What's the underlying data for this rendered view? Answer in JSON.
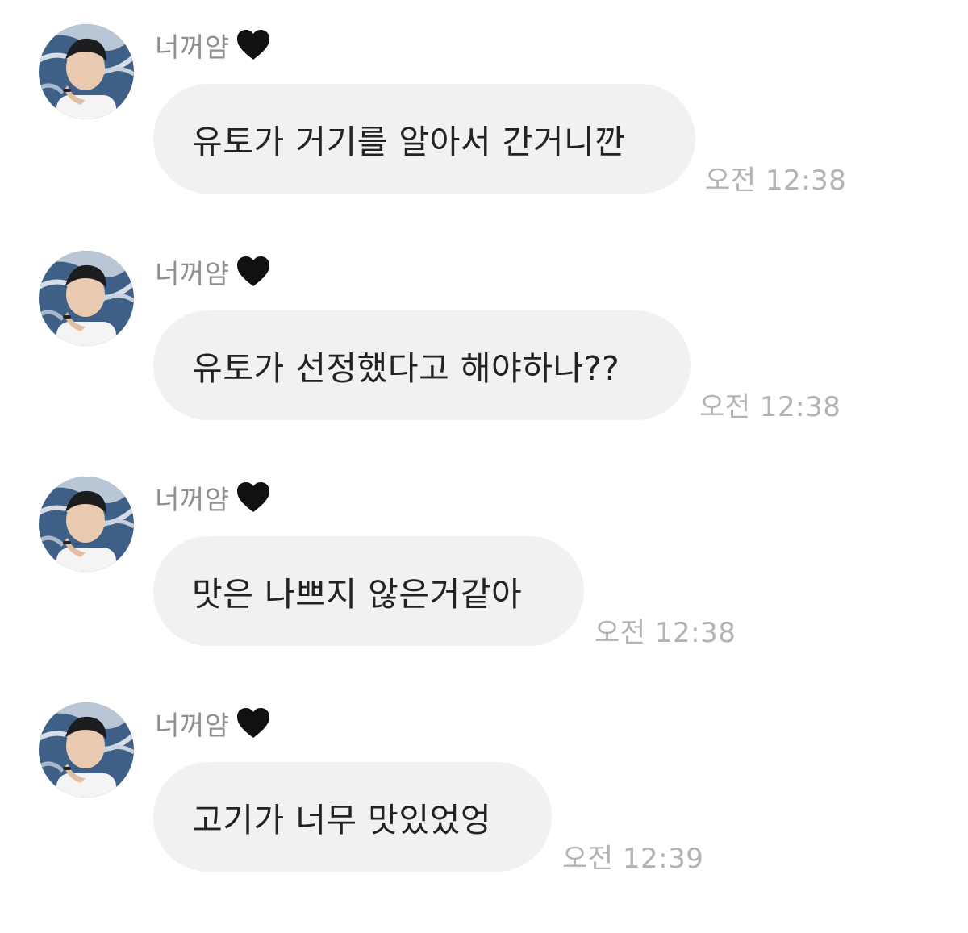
{
  "messages": [
    {
      "sender": "너꺼얌",
      "sender_icon": "black-heart-icon",
      "text": "유토가 거기를 알아서 간거니깐",
      "time": "오전 12:38"
    },
    {
      "sender": "너꺼얌",
      "sender_icon": "black-heart-icon",
      "text": "유토가 선정했다고 해야하나??",
      "time": "오전 12:38"
    },
    {
      "sender": "너꺼얌",
      "sender_icon": "black-heart-icon",
      "text": "맛은 나쁘지 않은거같아",
      "time": "오전 12:38"
    },
    {
      "sender": "너꺼얌",
      "sender_icon": "black-heart-icon",
      "text": "고기가 너무 맛있었엉",
      "time": "오전 12:39"
    }
  ],
  "colors": {
    "background": "#ffffff",
    "bubble": "#f1f1f4",
    "message_text": "#222222",
    "sender_text": "#8e8e93",
    "time_text": "#b2b2b7",
    "heart": "#111111"
  }
}
